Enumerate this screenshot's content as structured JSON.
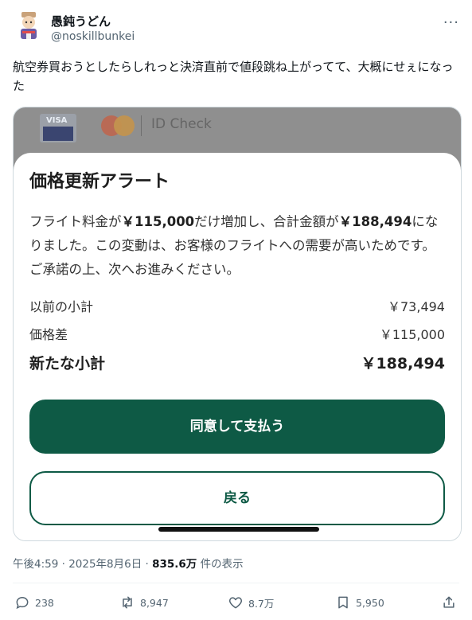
{
  "user": {
    "display_name": "愚鈍うどん",
    "handle": "@noskillbunkei"
  },
  "more_label": "···",
  "tweet_text": "航空券買おうとしたらしれっと決済直前で値段跳ね上がってて、大概にせぇになった",
  "screenshot": {
    "card_brand_text": "VISA",
    "id_check_label": "ID Check",
    "alert_title": "価格更新アラート",
    "message_part1": "フライト料金が",
    "increase_amount": "￥115,000",
    "message_part2": "だけ増加し、合計金額が",
    "total_amount": "￥188,494",
    "message_part3": "になりました。この変動は、お客様のフライトへの需要が高いためです。ご承諾の上、次へお進みください。",
    "rows": [
      {
        "label": "以前の小計",
        "value": "￥73,494"
      },
      {
        "label": "価格差",
        "value": "￥115,000"
      },
      {
        "label": "新たな小計",
        "value": "￥188,494"
      }
    ],
    "primary_button": "同意して支払う",
    "secondary_button": "戻る"
  },
  "meta": {
    "time_date": "午後4:59 · 2025年8月6日 · ",
    "views": "835.6万",
    "views_suffix": " 件の表示"
  },
  "actions": {
    "replies": "238",
    "reposts": "8,947",
    "likes": "8.7万",
    "bookmarks": "5,950"
  },
  "colors": {
    "button_green": "#0e5a45",
    "muted_text": "#536471"
  }
}
